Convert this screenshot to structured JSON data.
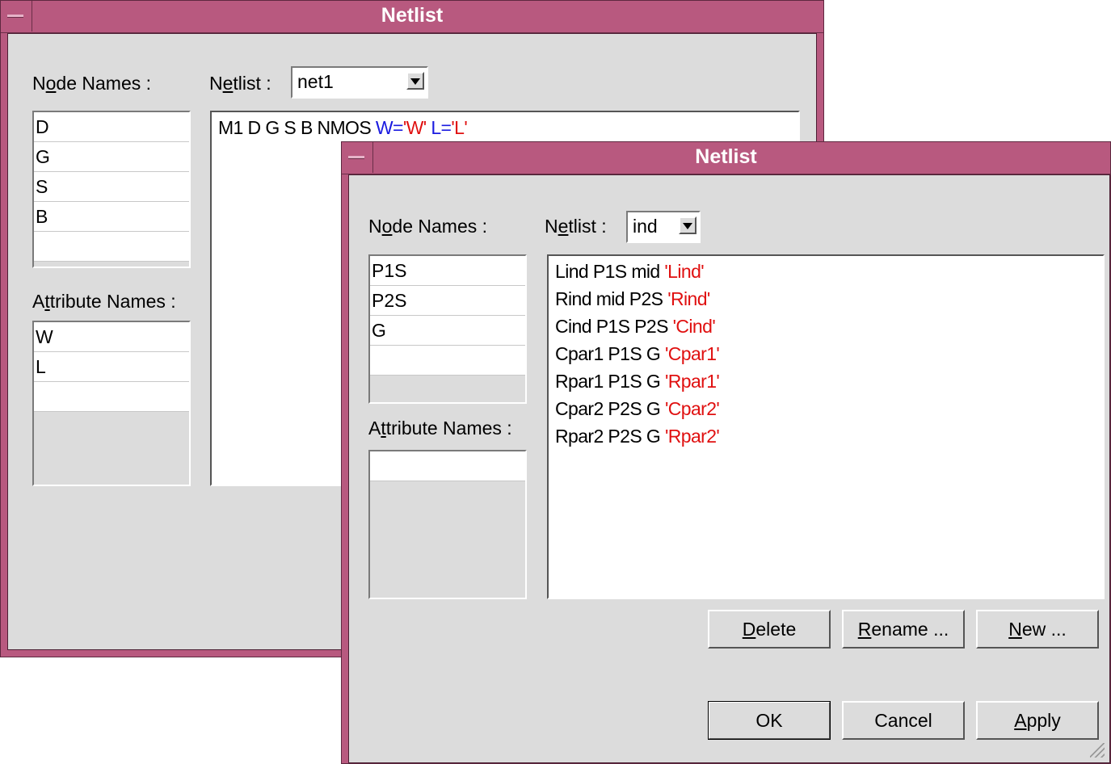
{
  "back_window": {
    "title": "Netlist",
    "node_names_label": "Node Names :",
    "netlist_label": "Netlist :",
    "netlist_selected": "net1",
    "node_names": [
      "D",
      "G",
      "S",
      "B",
      ""
    ],
    "attribute_names_label": "Attribute Names :",
    "attribute_names": [
      "W",
      "L",
      ""
    ],
    "netlist_line": {
      "prefix": "M1 D G S B NMOS ",
      "w_key": "W=",
      "w_value": "'W'",
      "l_key": "L=",
      "l_value": "'L'"
    }
  },
  "front_window": {
    "title": "Netlist",
    "node_names_label": "Node Names :",
    "netlist_label": "Netlist :",
    "netlist_selected": "ind",
    "node_names": [
      "P1S",
      "P2S",
      "G",
      ""
    ],
    "attribute_names_label": "Attribute Names :",
    "attribute_names": [
      ""
    ],
    "netlist_lines": [
      {
        "text": "Lind P1S mid ",
        "value": "'Lind'"
      },
      {
        "text": "Rind mid P2S ",
        "value": "'Rind'"
      },
      {
        "text": "Cind P1S P2S ",
        "value": "'Cind'"
      },
      {
        "text": "Cpar1 P1S G ",
        "value": "'Cpar1'"
      },
      {
        "text": "Rpar1 P1S G ",
        "value": "'Rpar1'"
      },
      {
        "text": "Cpar2 P2S G ",
        "value": "'Cpar2'"
      },
      {
        "text": "Rpar2 P2S G ",
        "value": "'Rpar2'"
      }
    ],
    "buttons": {
      "delete": "Delete",
      "rename": "Rename ...",
      "new": "New ...",
      "ok": "OK",
      "cancel": "Cancel",
      "apply": "Apply"
    }
  },
  "colors": {
    "title_bar": "#b8597f",
    "dialog_bg": "#dcdcdc",
    "value_red": "#e01010",
    "key_blue": "#1a1ae0"
  }
}
